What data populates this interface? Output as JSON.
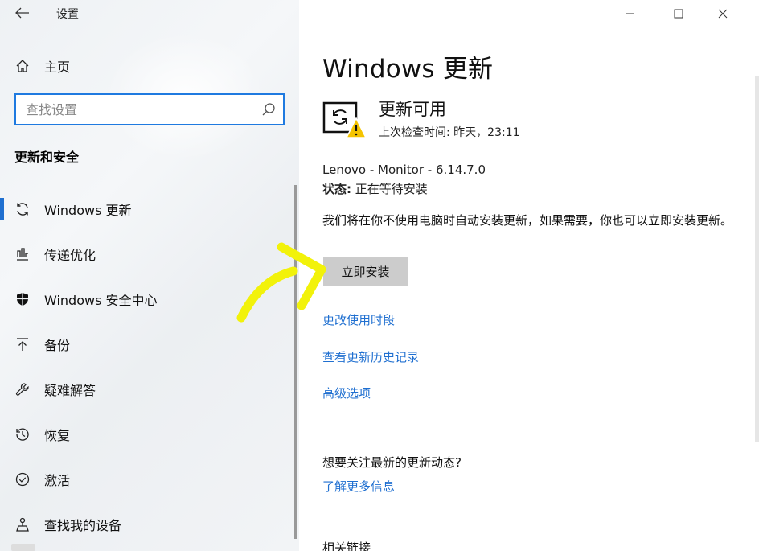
{
  "window": {
    "app_title": "设置",
    "back_icon": "back-arrow-icon",
    "controls": [
      "minimize-icon",
      "maximize-icon",
      "close-icon"
    ]
  },
  "sidebar": {
    "home_label": "主页",
    "search_placeholder": "查找设置",
    "section_title": "更新和安全",
    "items": [
      {
        "label": "Windows 更新",
        "icon": "sync-icon",
        "active": true
      },
      {
        "label": "传递优化",
        "icon": "delivery-optimization-icon"
      },
      {
        "label": "Windows 安全中心",
        "icon": "shield-icon"
      },
      {
        "label": "备份",
        "icon": "backup-arrow-icon"
      },
      {
        "label": "疑难解答",
        "icon": "wrench-icon"
      },
      {
        "label": "恢复",
        "icon": "recovery-icon"
      },
      {
        "label": "激活",
        "icon": "check-circle-icon"
      },
      {
        "label": "查找我的设备",
        "icon": "find-device-icon"
      }
    ]
  },
  "main": {
    "title": "Windows 更新",
    "status_title": "更新可用",
    "last_check": "上次检查时间: 昨天，23:11",
    "package_name": "Lenovo - Monitor - 6.14.7.0",
    "package_status_label": "状态:",
    "package_status_value": "正在等待安装",
    "description": "我们将在你不使用电脑时自动安装更新，如果需要，你也可以立即安装更新。",
    "install_button": "立即安装",
    "links": [
      "更改使用时段",
      "查看更新历史记录",
      "高级选项"
    ],
    "follow_question": "想要关注最新的更新动态?",
    "learn_more": "了解更多信息",
    "related_links": "相关链接"
  },
  "colors": {
    "accent": "#1f6fd0",
    "search_border": "#1f7ae0",
    "button_bg": "#cccccc",
    "annotation_arrow": "#f2f20a",
    "warning": "#f5c400"
  }
}
